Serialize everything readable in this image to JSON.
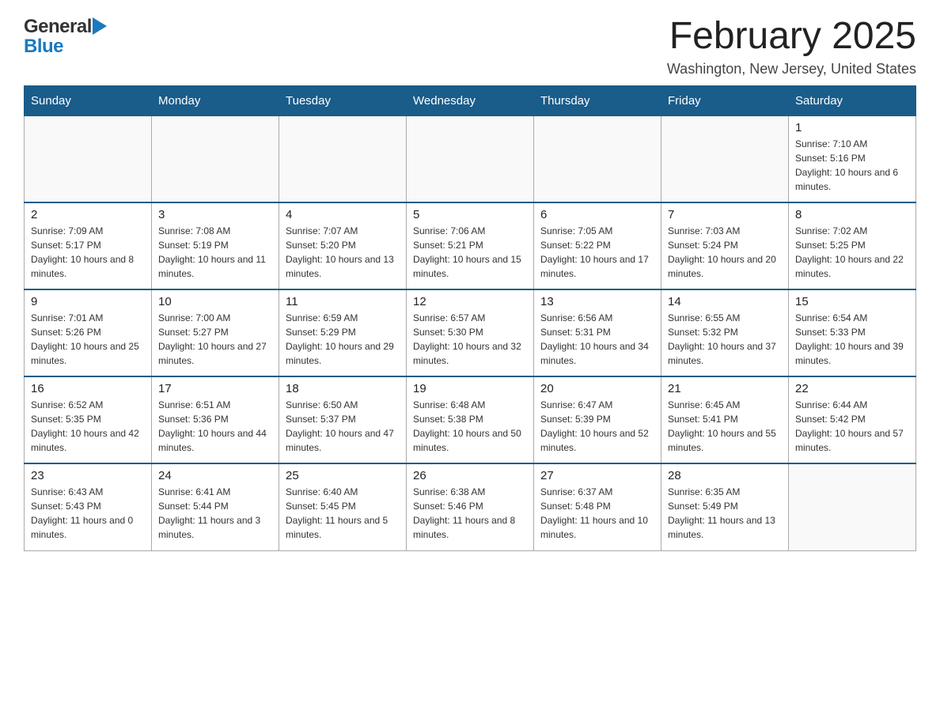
{
  "logo": {
    "general": "General",
    "blue": "Blue"
  },
  "header": {
    "title": "February 2025",
    "subtitle": "Washington, New Jersey, United States"
  },
  "days_of_week": [
    "Sunday",
    "Monday",
    "Tuesday",
    "Wednesday",
    "Thursday",
    "Friday",
    "Saturday"
  ],
  "weeks": [
    {
      "days": [
        {
          "date": "",
          "info": ""
        },
        {
          "date": "",
          "info": ""
        },
        {
          "date": "",
          "info": ""
        },
        {
          "date": "",
          "info": ""
        },
        {
          "date": "",
          "info": ""
        },
        {
          "date": "",
          "info": ""
        },
        {
          "date": "1",
          "info": "Sunrise: 7:10 AM\nSunset: 5:16 PM\nDaylight: 10 hours and 6 minutes."
        }
      ]
    },
    {
      "days": [
        {
          "date": "2",
          "info": "Sunrise: 7:09 AM\nSunset: 5:17 PM\nDaylight: 10 hours and 8 minutes."
        },
        {
          "date": "3",
          "info": "Sunrise: 7:08 AM\nSunset: 5:19 PM\nDaylight: 10 hours and 11 minutes."
        },
        {
          "date": "4",
          "info": "Sunrise: 7:07 AM\nSunset: 5:20 PM\nDaylight: 10 hours and 13 minutes."
        },
        {
          "date": "5",
          "info": "Sunrise: 7:06 AM\nSunset: 5:21 PM\nDaylight: 10 hours and 15 minutes."
        },
        {
          "date": "6",
          "info": "Sunrise: 7:05 AM\nSunset: 5:22 PM\nDaylight: 10 hours and 17 minutes."
        },
        {
          "date": "7",
          "info": "Sunrise: 7:03 AM\nSunset: 5:24 PM\nDaylight: 10 hours and 20 minutes."
        },
        {
          "date": "8",
          "info": "Sunrise: 7:02 AM\nSunset: 5:25 PM\nDaylight: 10 hours and 22 minutes."
        }
      ]
    },
    {
      "days": [
        {
          "date": "9",
          "info": "Sunrise: 7:01 AM\nSunset: 5:26 PM\nDaylight: 10 hours and 25 minutes."
        },
        {
          "date": "10",
          "info": "Sunrise: 7:00 AM\nSunset: 5:27 PM\nDaylight: 10 hours and 27 minutes."
        },
        {
          "date": "11",
          "info": "Sunrise: 6:59 AM\nSunset: 5:29 PM\nDaylight: 10 hours and 29 minutes."
        },
        {
          "date": "12",
          "info": "Sunrise: 6:57 AM\nSunset: 5:30 PM\nDaylight: 10 hours and 32 minutes."
        },
        {
          "date": "13",
          "info": "Sunrise: 6:56 AM\nSunset: 5:31 PM\nDaylight: 10 hours and 34 minutes."
        },
        {
          "date": "14",
          "info": "Sunrise: 6:55 AM\nSunset: 5:32 PM\nDaylight: 10 hours and 37 minutes."
        },
        {
          "date": "15",
          "info": "Sunrise: 6:54 AM\nSunset: 5:33 PM\nDaylight: 10 hours and 39 minutes."
        }
      ]
    },
    {
      "days": [
        {
          "date": "16",
          "info": "Sunrise: 6:52 AM\nSunset: 5:35 PM\nDaylight: 10 hours and 42 minutes."
        },
        {
          "date": "17",
          "info": "Sunrise: 6:51 AM\nSunset: 5:36 PM\nDaylight: 10 hours and 44 minutes."
        },
        {
          "date": "18",
          "info": "Sunrise: 6:50 AM\nSunset: 5:37 PM\nDaylight: 10 hours and 47 minutes."
        },
        {
          "date": "19",
          "info": "Sunrise: 6:48 AM\nSunset: 5:38 PM\nDaylight: 10 hours and 50 minutes."
        },
        {
          "date": "20",
          "info": "Sunrise: 6:47 AM\nSunset: 5:39 PM\nDaylight: 10 hours and 52 minutes."
        },
        {
          "date": "21",
          "info": "Sunrise: 6:45 AM\nSunset: 5:41 PM\nDaylight: 10 hours and 55 minutes."
        },
        {
          "date": "22",
          "info": "Sunrise: 6:44 AM\nSunset: 5:42 PM\nDaylight: 10 hours and 57 minutes."
        }
      ]
    },
    {
      "days": [
        {
          "date": "23",
          "info": "Sunrise: 6:43 AM\nSunset: 5:43 PM\nDaylight: 11 hours and 0 minutes."
        },
        {
          "date": "24",
          "info": "Sunrise: 6:41 AM\nSunset: 5:44 PM\nDaylight: 11 hours and 3 minutes."
        },
        {
          "date": "25",
          "info": "Sunrise: 6:40 AM\nSunset: 5:45 PM\nDaylight: 11 hours and 5 minutes."
        },
        {
          "date": "26",
          "info": "Sunrise: 6:38 AM\nSunset: 5:46 PM\nDaylight: 11 hours and 8 minutes."
        },
        {
          "date": "27",
          "info": "Sunrise: 6:37 AM\nSunset: 5:48 PM\nDaylight: 11 hours and 10 minutes."
        },
        {
          "date": "28",
          "info": "Sunrise: 6:35 AM\nSunset: 5:49 PM\nDaylight: 11 hours and 13 minutes."
        },
        {
          "date": "",
          "info": ""
        }
      ]
    }
  ]
}
